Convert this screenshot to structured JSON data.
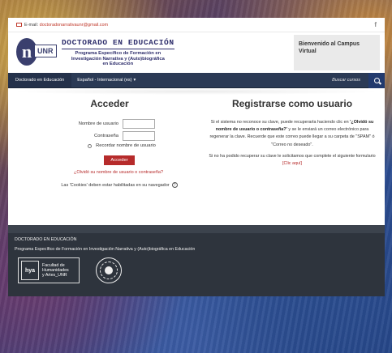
{
  "topbar": {
    "email_label": "E-mail:",
    "email": "doctoradonarrativaunr@gmail.com"
  },
  "brand": {
    "logo_letter": "n",
    "logo_unr": "UNR",
    "title": "DOCTORADO EN EDUCACIÓN",
    "subtitle_lines": [
      "Programa Específico de Formación en",
      "Investigación Narrativa y (Auto)biográfica",
      "en Educación"
    ]
  },
  "welcome": {
    "text": "Bienvenido al Campus Virtual"
  },
  "nav": {
    "home": "Doctorado en Educación",
    "language": "Español - Internacional (es)",
    "search": "Buscar cursos"
  },
  "login": {
    "title": "Acceder",
    "username_label": "Nombre de usuario",
    "password_label": "Contraseña",
    "remember_label": "Recordar nombre de usuario",
    "submit": "Acceder",
    "forgot": "¿Olvidó su nombre de usuario o contraseña?",
    "cookies": "Las 'Cookies' deben estar habilitadas en su navegador"
  },
  "register": {
    "title": "Registrarse como usuario",
    "p1_a": "Si el sistema no reconoce su clave, puede recuperarla haciendo clic en ",
    "p1_b": "'¿Olvidó su nombre de usuario o contraseña?'",
    "p1_c": " y se le enviará un correo electrónico para regenerar la clave. Recuerde que este correo puede llegar a su carpeta de \"SPAM\" ó \"Correo no deseado\".",
    "p2_a": "Si no ha podido recuperar su clave le solicitamos que complete el siguiente formulario ",
    "p2_link": "[Clic aquí]"
  },
  "footer": {
    "title": "DOCTORADO EN EDUCACIÓN",
    "subtitle": "Programa Específico de Formación en Investigación Narrativa y (Auto)biográfica en Educación",
    "hya_mark": "hya",
    "hya_text_lines": [
      "Facultad de",
      "Humanidades",
      "y Artes_UNR"
    ]
  },
  "colors": {
    "accent_red": "#b62b2b",
    "navbar": "#2b3a55",
    "footer": "#2e343d",
    "brand_blue": "#2d2d6b"
  }
}
